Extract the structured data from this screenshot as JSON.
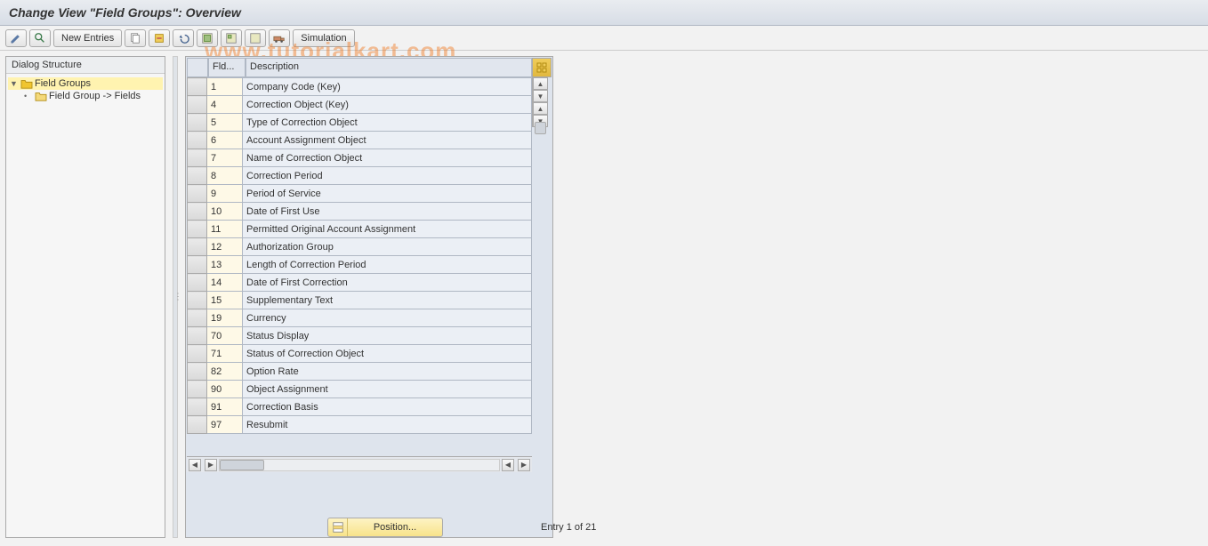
{
  "title": "Change View \"Field Groups\": Overview",
  "watermark": "www.tutorialkart.com",
  "toolbar": {
    "new_entries": "New Entries",
    "simulation": "Simulation"
  },
  "sidebar": {
    "title": "Dialog Structure",
    "items": [
      {
        "label": "Field Groups",
        "open": true,
        "selected": true,
        "level": 0
      },
      {
        "label": "Field Group -> Fields",
        "open": false,
        "selected": false,
        "level": 1
      }
    ]
  },
  "table": {
    "columns": {
      "fld": "Fld...",
      "description": "Description"
    },
    "rows": [
      {
        "fld": "1",
        "description": "Company Code (Key)"
      },
      {
        "fld": "4",
        "description": "Correction Object (Key)"
      },
      {
        "fld": "5",
        "description": "Type of Correction Object"
      },
      {
        "fld": "6",
        "description": "Account Assignment Object"
      },
      {
        "fld": "7",
        "description": "Name of Correction Object"
      },
      {
        "fld": "8",
        "description": "Correction Period"
      },
      {
        "fld": "9",
        "description": "Period of Service"
      },
      {
        "fld": "10",
        "description": "Date of First Use"
      },
      {
        "fld": "11",
        "description": "Permitted Original Account Assignment"
      },
      {
        "fld": "12",
        "description": "Authorization Group"
      },
      {
        "fld": "13",
        "description": "Length of Correction Period"
      },
      {
        "fld": "14",
        "description": "Date of First Correction"
      },
      {
        "fld": "15",
        "description": "Supplementary Text"
      },
      {
        "fld": "19",
        "description": "Currency"
      },
      {
        "fld": "70",
        "description": "Status Display"
      },
      {
        "fld": "71",
        "description": "Status of Correction Object"
      },
      {
        "fld": "82",
        "description": "Option Rate"
      },
      {
        "fld": "90",
        "description": "Object Assignment"
      },
      {
        "fld": "91",
        "description": "Correction Basis"
      },
      {
        "fld": "97",
        "description": "Resubmit"
      }
    ]
  },
  "footer": {
    "position_label": "Position...",
    "entry_count": "Entry 1 of 21"
  }
}
